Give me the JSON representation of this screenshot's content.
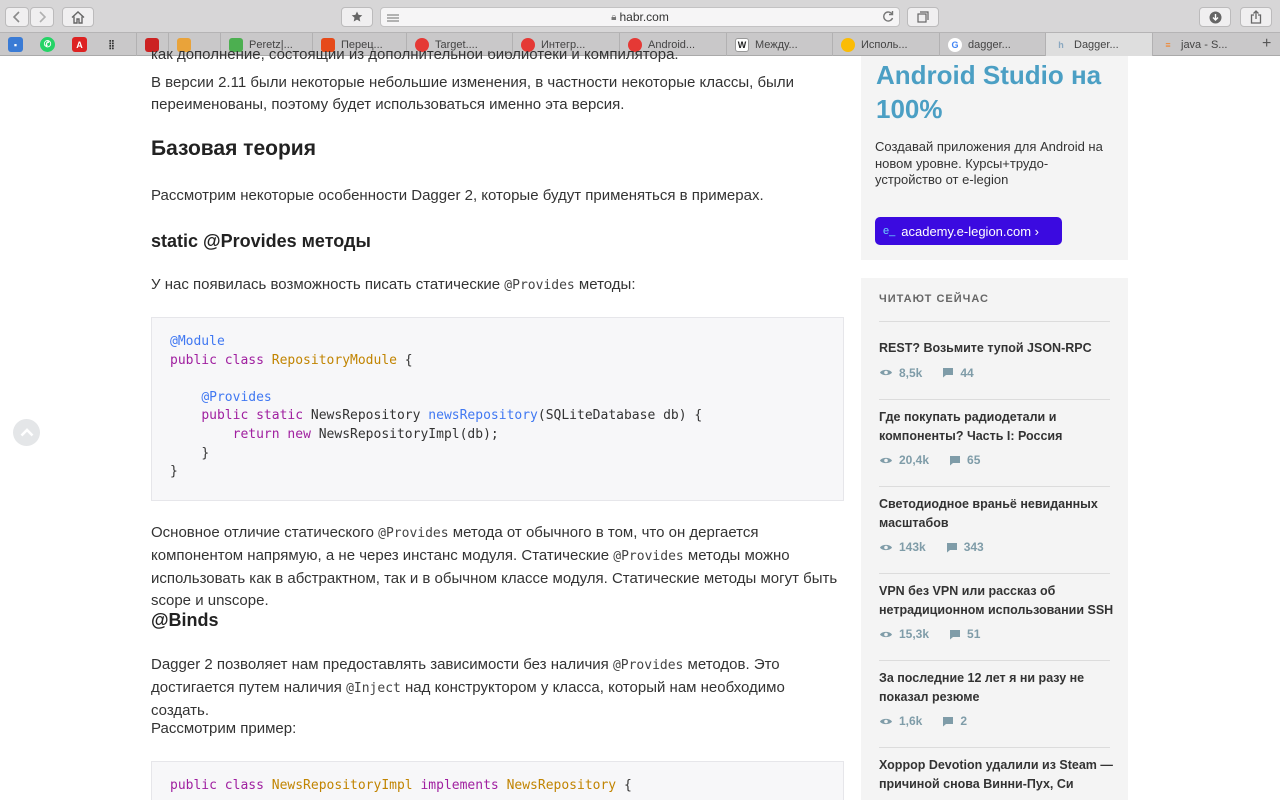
{
  "browser": {
    "url": "habr.com",
    "pinned": [
      {
        "icon": "messages-icon",
        "color": "#3a7bd5"
      },
      {
        "icon": "whatsapp-icon",
        "color": "#25d366"
      },
      {
        "icon": "pdf-icon",
        "color": "#d22"
      },
      {
        "icon": "apps-grid-icon",
        "color": "#555"
      }
    ],
    "tabs": [
      {
        "label": "",
        "color": "#c22"
      },
      {
        "label": "",
        "color": "#e9a33a"
      },
      {
        "label": "Peretz|...",
        "color": "#4caf50"
      },
      {
        "label": "Перец...",
        "color": "#e64a19"
      },
      {
        "label": "Target....",
        "color": "#e53935"
      },
      {
        "label": "Интегр...",
        "color": "#e53935"
      },
      {
        "label": "Android...",
        "color": "#e53935"
      },
      {
        "label": "Между...",
        "color": "#333"
      },
      {
        "label": "Исполь...",
        "color": "#fbbc05"
      },
      {
        "label": "dagger...",
        "color": "#4285f4"
      },
      {
        "label": "Dagger...",
        "color": "#8aa8c0"
      },
      {
        "label": "java - S...",
        "color": "#f48024"
      }
    ]
  },
  "article": {
    "intro_cut": "как дополнение, состоящий из дополнительной библиотеки и компилятора.",
    "intro": "В версии 2.11 были некоторые небольшие изменения, в частности некоторые классы, были переименованы, поэтому будет использоваться именно эта версия.",
    "h_base": "Базовая теория",
    "p_base": "Рассмотрим некоторые особенности Dagger 2, которые будут применяться в примерах.",
    "h_static": "static @Provides методы",
    "p_static_a": "У нас появилась возможность писать статические ",
    "p_static_code": "@Provides",
    "p_static_b": " методы:",
    "code1": {
      "l1": "@Module",
      "l2_kw": "public class ",
      "l2_cls": "RepositoryModule",
      "l2_rest": " {",
      "l4": "@Provides",
      "l5_kw": "public static ",
      "l5_type": "NewsRepository ",
      "l5_fn": "newsRepository",
      "l5_rest": "(SQLiteDatabase db) {",
      "l6_kw": "return new ",
      "l6_rest": "NewsRepositoryImpl(db);",
      "l7": "}",
      "l8": "}"
    },
    "p_diff_a": "Основное отличие статического ",
    "p_diff_code1": "@Provides",
    "p_diff_b": " метода от обычного в том, что он дергается компонентом напрямую, а не через инстанс модуля. Статические ",
    "p_diff_code2": "@Provides",
    "p_diff_c": " методы можно использовать как в абстрактном, так и в обычном классе модуля. Статические методы могут быть scope и unscope.",
    "h_binds": "@Binds",
    "p_binds_a": "Dagger 2 позволяет нам предоставлять зависимости без наличия ",
    "p_binds_code1": "@Provides",
    "p_binds_b": " методов. Это достигается путем наличия ",
    "p_binds_code2": "@Inject",
    "p_binds_c": " над конструктором у класса, который нам необходимо создать.",
    "p_example": "Рассмотрим пример:",
    "code2": {
      "l1_kw": "public class ",
      "l1_cls": "NewsRepositoryImpl",
      "l1_kw2": " implements ",
      "l1_cls2": "NewsRepository",
      "l1_rest": " {"
    }
  },
  "ad": {
    "title": "Android Studio на 100%",
    "text": "Создавай приложения для Android на новом уровне. Курсы+трудо-устройство от e-legion",
    "button": "academy.e-legion.com ›",
    "logo": "e_"
  },
  "reading": {
    "heading": "ЧИТАЮТ СЕЙЧАС",
    "items": [
      {
        "title": "REST? Возьмите тупой JSON-RPC",
        "views": "8,5k",
        "comments": "44"
      },
      {
        "title": "Где покупать радиодетали и компоненты? Часть I: Россия",
        "views": "20,4k",
        "comments": "65"
      },
      {
        "title": "Светодиодное враньё невиданных масштабов",
        "views": "143k",
        "comments": "343"
      },
      {
        "title": "VPN без VPN или рассказ об нетрадиционном использовании SSH",
        "views": "15,3k",
        "comments": "51"
      },
      {
        "title": "За последние 12 лет я ни разу не показал резюме",
        "views": "1,6k",
        "comments": "2"
      },
      {
        "title": "Хоррор Devotion удалили из Steam — причиной снова Винни-Пух, Си",
        "views": "",
        "comments": ""
      }
    ]
  }
}
